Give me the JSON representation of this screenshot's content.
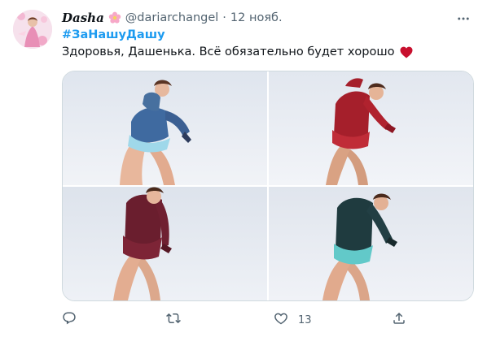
{
  "tweet": {
    "author": {
      "display_name": "Dasha",
      "handle": "@dariarchangel",
      "name_emoji": "flower-icon",
      "avatar": "avatar"
    },
    "separator": "·",
    "time": "12 нояб.",
    "hashtag": "#ЗаНашуДашу",
    "text": "Здоровья, Дашенька. Всё обязательно будет хорошо",
    "text_emoji": "heart-icon",
    "more_icon": "more-icon",
    "media": [
      {
        "name": "photo-1",
        "costume": "blue"
      },
      {
        "name": "photo-2",
        "costume": "red"
      },
      {
        "name": "photo-3",
        "costume": "burgundy"
      },
      {
        "name": "photo-4",
        "costume": "dark-teal"
      }
    ],
    "actions": {
      "reply_icon": "reply-icon",
      "retweet_icon": "retweet-icon",
      "like_icon": "like-icon",
      "like_count": "13",
      "share_icon": "share-icon"
    }
  },
  "colors": {
    "accent": "#1d9bf0",
    "text": "#0f1419",
    "secondary": "#536471",
    "heart": "#c8102e",
    "border": "#cfd9de"
  }
}
